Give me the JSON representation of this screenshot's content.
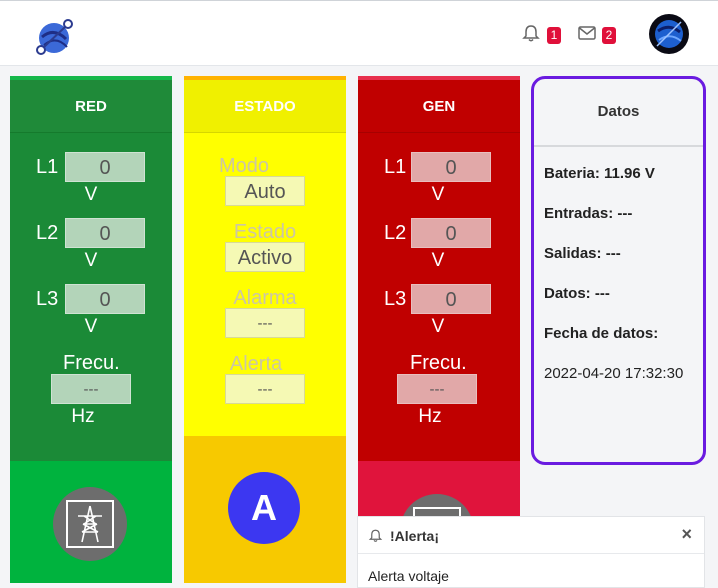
{
  "header": {
    "notifications_count": "1",
    "messages_count": "2"
  },
  "red": {
    "title": "RED",
    "l1_label": "L1",
    "l1_value": "0",
    "l1_unit": "V",
    "l2_label": "L2",
    "l2_value": "0",
    "l2_unit": "V",
    "l3_label": "L3",
    "l3_value": "0",
    "l3_unit": "V",
    "freq_label": "Frecu.",
    "freq_value": "---",
    "freq_unit": "Hz",
    "icon": "power-tower-icon"
  },
  "estado": {
    "title": "ESTADO",
    "modo_label": "Modo",
    "modo_value": "Auto",
    "estado_label": "Estado",
    "estado_value": "Activo",
    "alarma_label": "Alarma",
    "alarma_value": "---",
    "alerta_label": "Alerta",
    "alerta_value": "---",
    "mode_badge": "A"
  },
  "gen": {
    "title": "GEN",
    "l1_label": "L1",
    "l1_value": "0",
    "l1_unit": "V",
    "l2_label": "L2",
    "l2_value": "0",
    "l2_unit": "V",
    "l3_label": "L3",
    "l3_value": "0",
    "l3_unit": "V",
    "freq_label": "Frecu.",
    "freq_value": "---",
    "freq_unit": "Hz",
    "icon": "generator-icon"
  },
  "datos": {
    "title": "Datos",
    "bateria_label": "Bateria:",
    "bateria_value": "11.96 V",
    "entradas_label": "Entradas:",
    "entradas_value": "---",
    "salidas_label": "Salidas:",
    "salidas_value": "---",
    "datos_label": "Datos:",
    "datos_value": "---",
    "fecha_label": "Fecha de datos:",
    "fecha_value": "2022-04-20 17:32:30"
  },
  "toast": {
    "title": "!Alerta¡",
    "close": "×",
    "message": "Alerta voltaje"
  },
  "colors": {
    "red_panel": "#1b8a37",
    "estado_panel": "#ffff00",
    "gen_panel": "#c00000",
    "datos_border": "#6a1be0",
    "badge": "#e0103a"
  }
}
